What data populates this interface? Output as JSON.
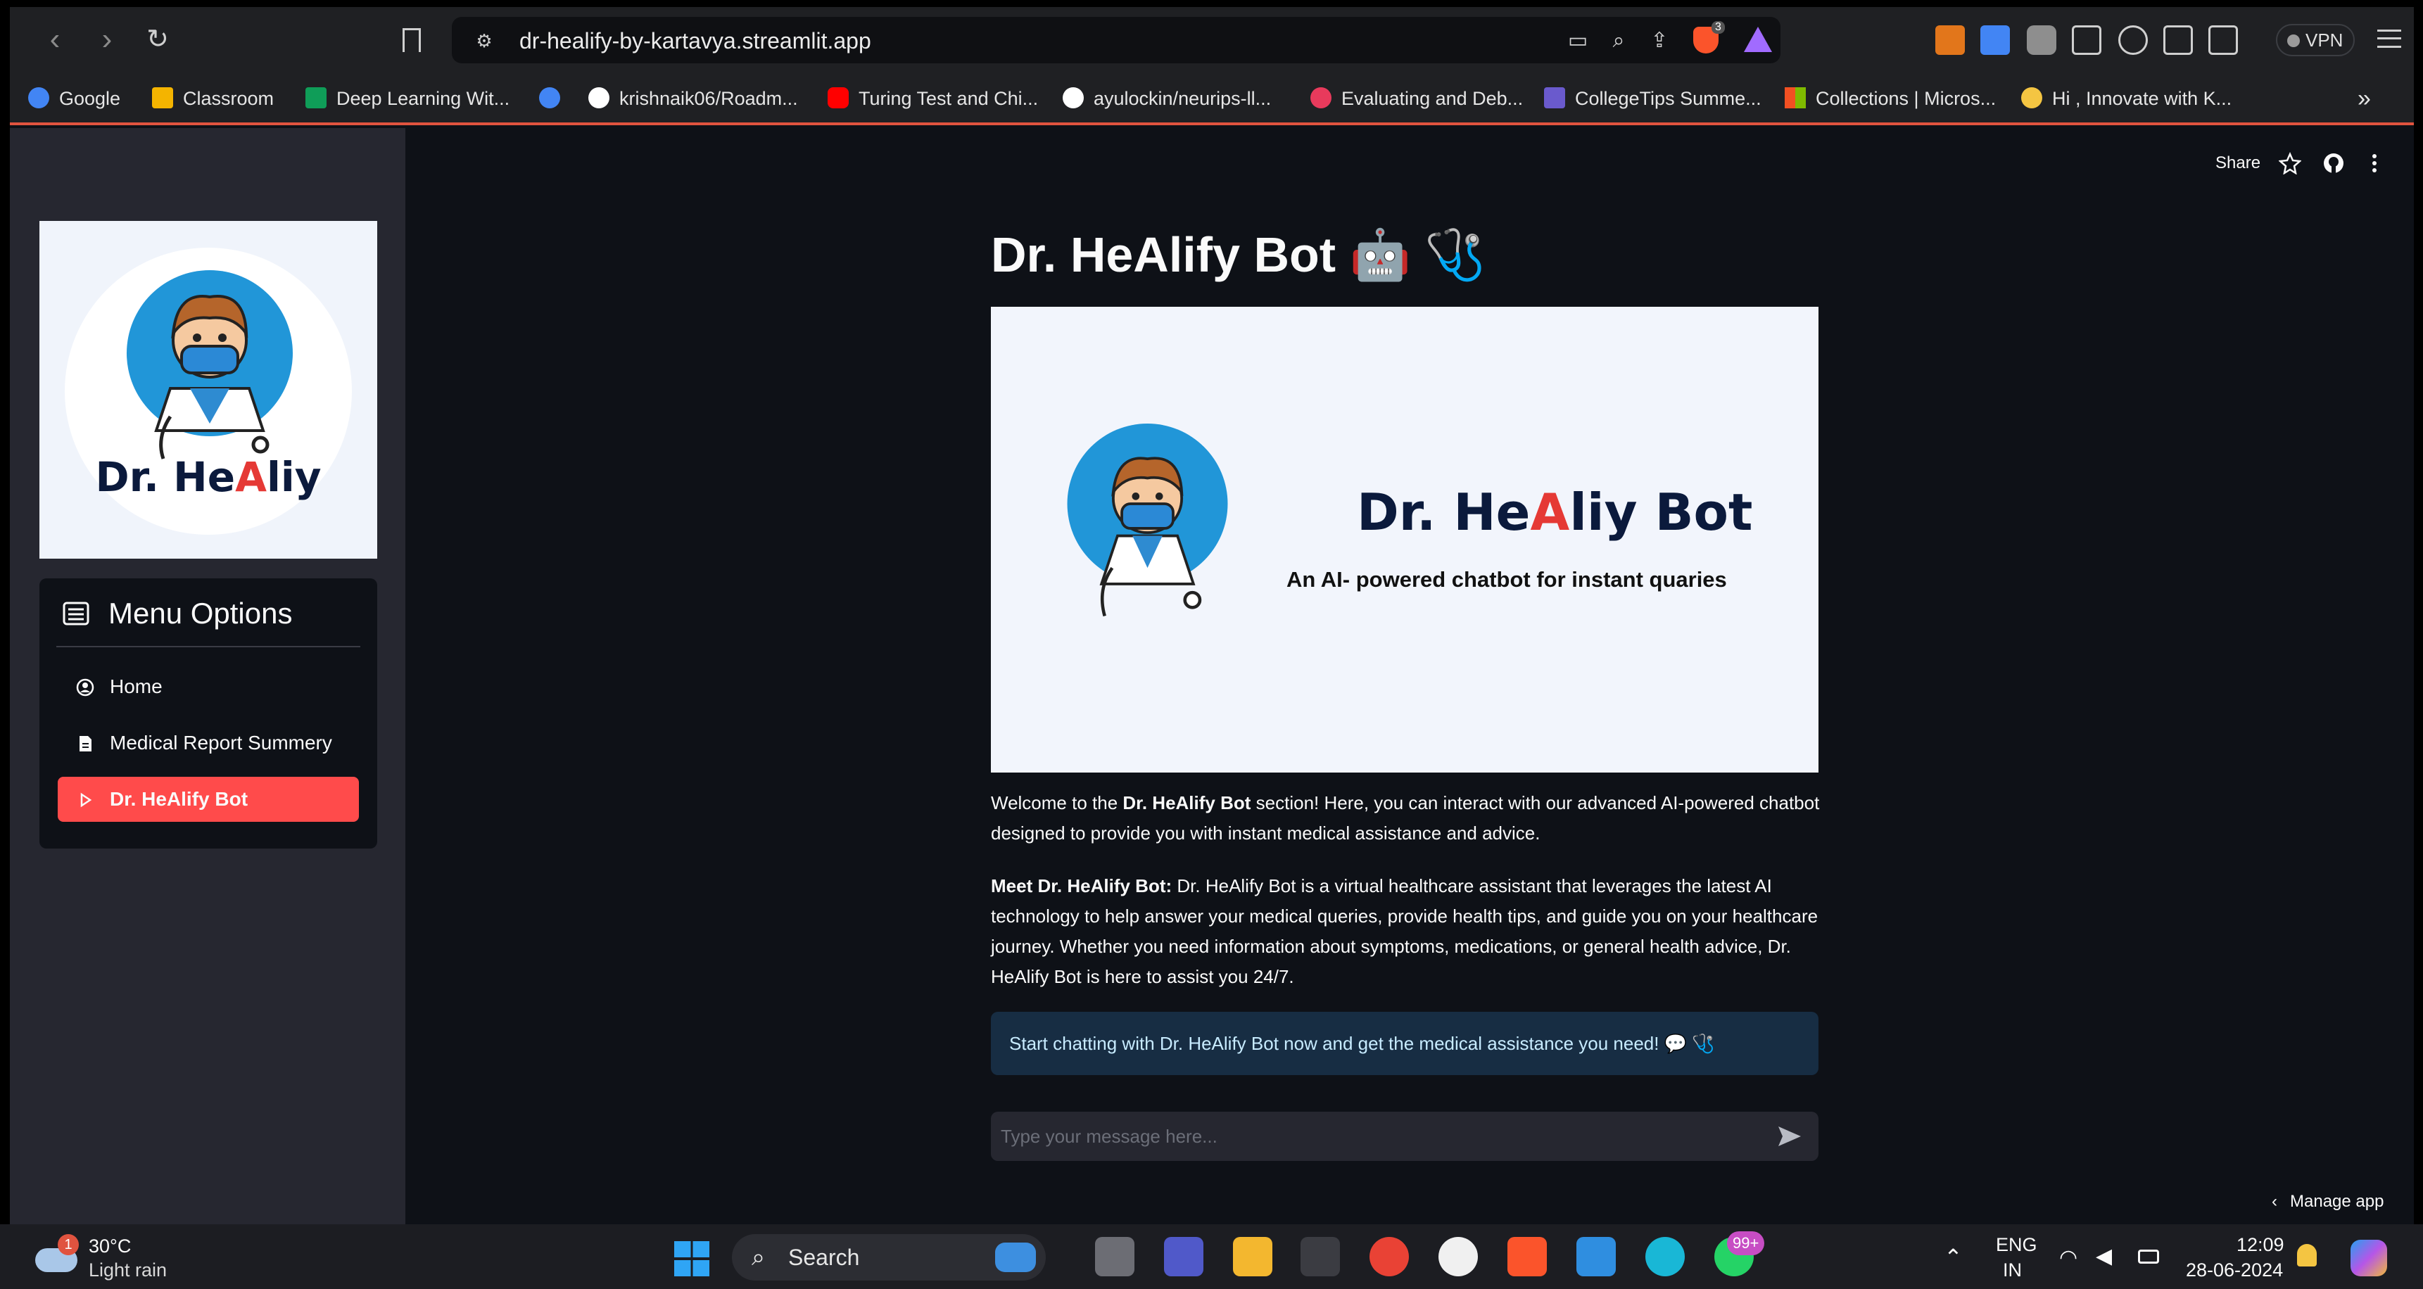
{
  "browser": {
    "url": "dr-healify-by-kartavya.streamlit.app",
    "vpn_label": "VPN",
    "brave_badge": "3",
    "bookmarks": [
      {
        "label": "Google",
        "icon": "google-icon",
        "color": "#4285f4"
      },
      {
        "label": "Classroom",
        "icon": "classroom-icon",
        "color": "#f4b400"
      },
      {
        "label": "Deep Learning Wit...",
        "icon": "drive-icon",
        "color": "#0f9d58"
      },
      {
        "label": "",
        "icon": "google-icon",
        "color": "#4285f4"
      },
      {
        "label": "krishnaik06/Roadm...",
        "icon": "github-icon",
        "color": "#ffffff"
      },
      {
        "label": "Turing Test and Chi...",
        "icon": "youtube-icon",
        "color": "#ff0000"
      },
      {
        "label": "ayulockin/neurips-ll...",
        "icon": "github-icon",
        "color": "#ffffff"
      },
      {
        "label": "Evaluating and Deb...",
        "icon": "target-icon",
        "color": "#e83a5c"
      },
      {
        "label": "CollegeTips Summe...",
        "icon": "list-icon",
        "color": "#6a5acd"
      },
      {
        "label": "Collections | Micros...",
        "icon": "microsoft-icon",
        "color": "#f25022"
      },
      {
        "label": "Hi , Innovate with K...",
        "icon": "avatar-icon",
        "color": "#f4c542"
      }
    ]
  },
  "header": {
    "share_label": "Share"
  },
  "sidebar": {
    "logo_text_pre": "Dr. He",
    "logo_text_red": "A",
    "logo_text_post": "liy",
    "menu_title": "Menu Options",
    "items": [
      {
        "label": "Home",
        "icon": "person-circle-icon"
      },
      {
        "label": "Medical Report Summery",
        "icon": "document-icon"
      },
      {
        "label": "Dr. HeAlify Bot",
        "icon": "play-icon",
        "active": true
      }
    ]
  },
  "main": {
    "title": "Dr. HeAlify Bot 🤖 🩺",
    "banner": {
      "title_pre": "Dr. He",
      "title_red": "A",
      "title_post": "liy Bot",
      "subtitle": "An AI- powered chatbot for instant quaries"
    },
    "welcome": {
      "pre": "Welcome to the ",
      "bold": "Dr. HeAlify Bot",
      "post": " section! Here, you can interact with our advanced AI-powered chatbot designed to provide you with instant medical assistance and advice."
    },
    "meet": {
      "bold": "Meet Dr. HeAlify Bot:",
      "text": " Dr. HeAlify Bot is a virtual healthcare assistant that leverages the latest AI technology to help answer your medical queries, provide health tips, and guide you on your healthcare journey. Whether you need information about symptoms, medications, or general health advice, Dr. HeAlify Bot is here to assist you 24/7."
    },
    "info": "Start chatting with Dr. HeAlify Bot now and get the medical assistance you need! 💬 🩺",
    "chat_placeholder": "Type your message here...",
    "manage_app": "Manage app"
  },
  "taskbar": {
    "weather_badge": "1",
    "temperature": "30°C",
    "weather": "Light rain",
    "search_label": "Search",
    "whatsapp_badge": "99+",
    "lang_top": "ENG",
    "lang_bottom": "IN",
    "time": "12:09",
    "date": "28-06-2024"
  },
  "colors": {
    "accent": "#ff4b4b",
    "info_bg": "#172d43",
    "sidebar_bg": "#262730",
    "app_bg": "#0e1117"
  }
}
